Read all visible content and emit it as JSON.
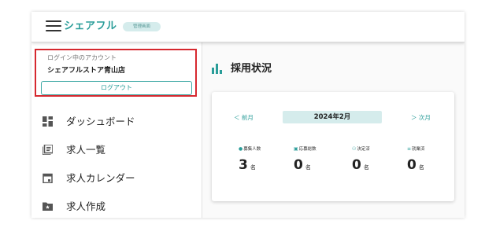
{
  "header": {
    "logo_text": "シェアフル",
    "admin_badge": "管理画面"
  },
  "account": {
    "caption": "ログイン中のアカウント",
    "name": "シェアフルストア青山店",
    "logout_label": "ログアウト"
  },
  "sidebar": {
    "items": [
      {
        "label": "ダッシュボード",
        "icon": "dashboard-icon"
      },
      {
        "label": "求人一覧",
        "icon": "list-icon"
      },
      {
        "label": "求人カレンダー",
        "icon": "calendar-icon"
      },
      {
        "label": "求人作成",
        "icon": "create-folder-icon"
      }
    ]
  },
  "main": {
    "title": "採用状況",
    "prev_label": "＜ 前月",
    "current_month": "2024年2月",
    "next_label": "＞ 次月",
    "stats": [
      {
        "label": "募集人数",
        "value": "3",
        "unit": "名",
        "icon": "person-icon"
      },
      {
        "label": "応募総数",
        "value": "0",
        "unit": "名",
        "icon": "id-card-icon"
      },
      {
        "label": "決定済",
        "value": "0",
        "unit": "名",
        "icon": "people-check-icon"
      },
      {
        "label": "就業済",
        "value": "0",
        "unit": "名",
        "icon": "work-done-icon"
      }
    ]
  },
  "colors": {
    "accent": "#2a9d99",
    "highlight_border": "#d6282f",
    "badge_bg": "#d5ecec"
  }
}
